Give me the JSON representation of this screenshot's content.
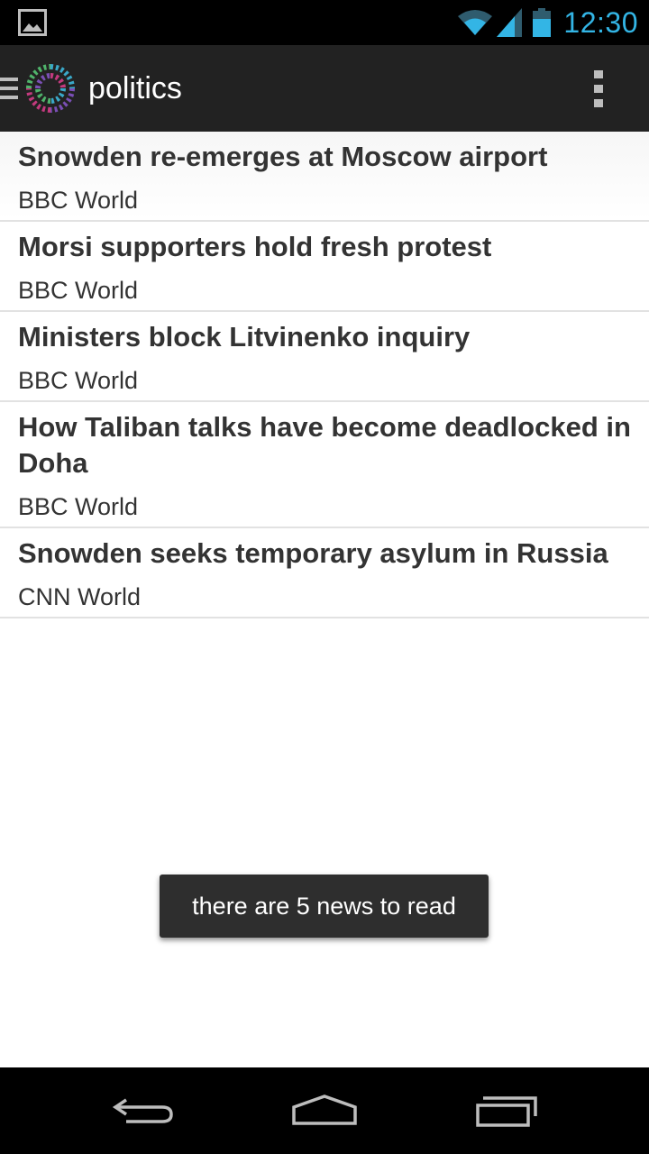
{
  "status_bar": {
    "time": "12:30",
    "accent_color": "#33b5e5",
    "icons": [
      "gallery-notification-icon",
      "wifi-icon",
      "cell-signal-icon",
      "battery-icon"
    ]
  },
  "action_bar": {
    "title": "politics",
    "background": "#222222"
  },
  "news": [
    {
      "title": "Snowden re-emerges at Moscow airport",
      "source": "BBC World"
    },
    {
      "title": "Morsi supporters hold fresh protest",
      "source": "BBC World"
    },
    {
      "title": "Ministers block Litvinenko inquiry",
      "source": "BBC World"
    },
    {
      "title": "How Taliban talks have become deadlocked in Doha",
      "source": "BBC World"
    },
    {
      "title": "Snowden seeks temporary asylum in Russia",
      "source": "CNN World"
    }
  ],
  "toast": {
    "message": "there are 5 news to read"
  },
  "nav_bar": {
    "icons": [
      "back-icon",
      "home-icon",
      "recent-apps-icon"
    ]
  }
}
